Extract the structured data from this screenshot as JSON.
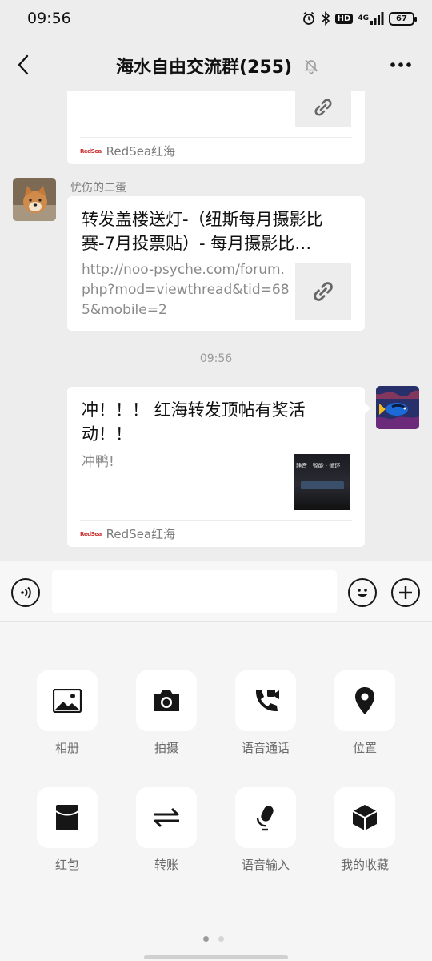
{
  "status_bar": {
    "time": "09:56",
    "hd_label": "HD",
    "network_label": "4G",
    "battery_level": "67"
  },
  "nav": {
    "title": "海水自由交流群(255)"
  },
  "messages": {
    "card1": {
      "source_logo": "RedSea",
      "source_name": "RedSea红海"
    },
    "msg2": {
      "sender": "忧伤的二蛋",
      "title": "转发盖楼送灯-（纽斯每月摄影比赛-7月投票贴）- 每月摄影比…",
      "url": "http://noo-psyche.com/forum.php?mod=viewthread&tid=685&mobile=2"
    },
    "time_divider": "09:56",
    "msg3": {
      "title": "冲！！！ 红海转发顶帖有奖活动！！",
      "desc": "冲鸭!",
      "thumb_text": "静音 · 智能 · 循环",
      "source_logo": "RedSea",
      "source_name": "RedSea红海"
    }
  },
  "input": {
    "placeholder": ""
  },
  "panel": {
    "items": [
      {
        "label": "相册",
        "icon": "photo-icon"
      },
      {
        "label": "拍摄",
        "icon": "camera-icon"
      },
      {
        "label": "语音通话",
        "icon": "voice-call-icon"
      },
      {
        "label": "位置",
        "icon": "location-icon"
      },
      {
        "label": "红包",
        "icon": "red-packet-icon"
      },
      {
        "label": "转账",
        "icon": "transfer-icon"
      },
      {
        "label": "语音输入",
        "icon": "microphone-icon"
      },
      {
        "label": "我的收藏",
        "icon": "favorites-icon"
      }
    ],
    "page_count": 2,
    "current_page": 1
  }
}
